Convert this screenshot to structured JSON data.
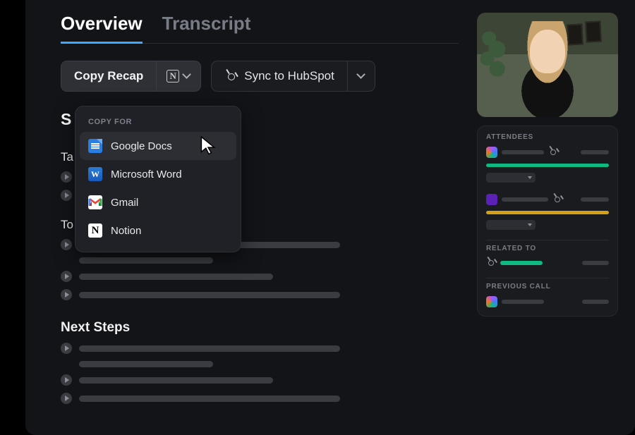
{
  "tabs": {
    "overview": "Overview",
    "transcript": "Transcript"
  },
  "toolbar": {
    "copy_label": "Copy Recap",
    "sync_label": "Sync to HubSpot"
  },
  "dropdown": {
    "heading": "COPY FOR",
    "items": [
      "Google Docs",
      "Microsoft Word",
      "Gmail",
      "Notion"
    ]
  },
  "sections": {
    "summary_fragment": "S",
    "talking_fragment": "Ta",
    "topics_fragment": "To",
    "next_steps": "Next Steps"
  },
  "side": {
    "attendees_label": "ATTENDEES",
    "related_label": "RELATED TO",
    "previous_label": "PREVIOUS CALL"
  }
}
